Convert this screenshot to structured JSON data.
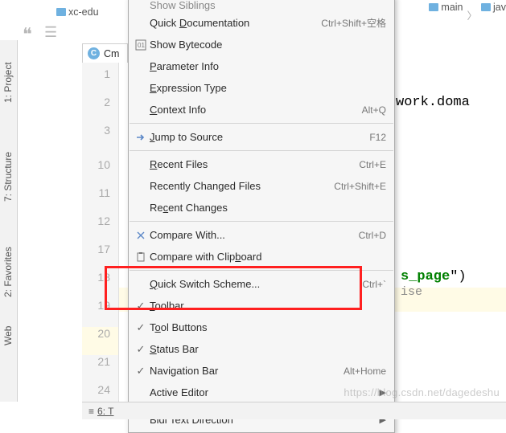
{
  "breadcrumb": {
    "project": "xc-edu",
    "right1": "main",
    "right2": "jav"
  },
  "tabs": {
    "current": "Cm"
  },
  "tool_windows": {
    "project": "1: Project",
    "structure": "7: Structure",
    "favorites": "2: Favorites",
    "web": "Web"
  },
  "line_numbers_1": [
    "1",
    "2",
    "3"
  ],
  "line_numbers_2": [
    "10",
    "11",
    "12",
    "17",
    "18",
    "19",
    "20",
    "21",
    "24"
  ],
  "code": {
    "frag1": "work.doma",
    "frag2_a": "s_page",
    "frag2_b": "\")",
    "frag2_tail": "ise"
  },
  "menu": {
    "show_siblings": {
      "label": "Show Siblings"
    },
    "quick_doc": {
      "label": "Quick Documentation",
      "u": "D",
      "shortcut": "Ctrl+Shift+空格"
    },
    "show_bytecode": {
      "label": "Show Bytecode"
    },
    "parameter_info": {
      "label": "Parameter Info",
      "u": "P"
    },
    "expression_type": {
      "label": "Expression Type",
      "u": "E"
    },
    "context_info": {
      "label": "Context Info",
      "u": "C",
      "shortcut": "Alt+Q"
    },
    "jump_to_source": {
      "label": "Jump to Source",
      "u": "J",
      "shortcut": "F12"
    },
    "recent_files": {
      "label": "Recent Files",
      "u": "R",
      "shortcut": "Ctrl+E"
    },
    "recently_changed": {
      "label": "Recently Changed Files",
      "shortcut": "Ctrl+Shift+E"
    },
    "recent_changes": {
      "label": "Recent Changes",
      "u": "c"
    },
    "compare_with": {
      "label": "Compare With...",
      "shortcut": "Ctrl+D"
    },
    "compare_clipboard": {
      "label": "Compare with Clipboard",
      "u": "b"
    },
    "quick_switch": {
      "label": "Quick Switch Scheme...",
      "u": "Q",
      "shortcut": "Ctrl+`"
    },
    "toolbar": {
      "label": "Toolbar",
      "u": "T"
    },
    "tool_buttons": {
      "label": "Tool Buttons",
      "u": "o"
    },
    "status_bar": {
      "label": "Status Bar",
      "u": "S"
    },
    "navigation_bar": {
      "label": "Navigation Bar",
      "u": "g",
      "shortcut": "Alt+Home"
    },
    "active_editor": {
      "label": "Active Editor"
    },
    "bidi": {
      "label": "Bidi Text Direction"
    }
  },
  "statusbar": {
    "label": "6: T"
  },
  "watermark": "https://blog.csdn.net/dagedeshu"
}
